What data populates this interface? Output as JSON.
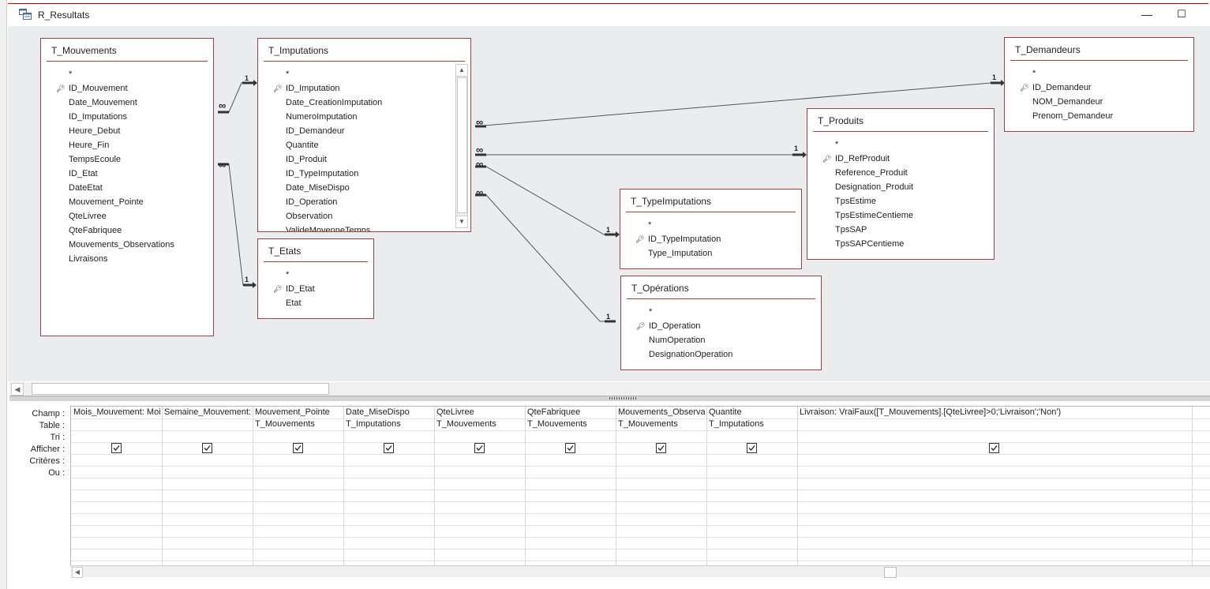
{
  "window": {
    "title": "R_Resultats",
    "minimize_glyph": "—",
    "maximize_glyph": "☐"
  },
  "tables": {
    "t_mouvements": {
      "name": "T_Mouvements",
      "fields": [
        "*",
        "ID_Mouvement",
        "Date_Mouvement",
        "ID_Imputations",
        "Heure_Debut",
        "Heure_Fin",
        "TempsEcoule",
        "ID_Etat",
        "DateEtat",
        "Mouvement_Pointe",
        "QteLivree",
        "QteFabriquee",
        "Mouvements_Observations",
        "Livraisons"
      ],
      "key_field": "ID_Mouvement"
    },
    "t_imputations": {
      "name": "T_Imputations",
      "fields": [
        "*",
        "ID_Imputation",
        "Date_CreationImputation",
        "NumeroImputation",
        "ID_Demandeur",
        "Quantite",
        "ID_Produit",
        "ID_TypeImputation",
        "Date_MiseDispo",
        "ID_Operation",
        "Observation",
        "ValideMoyenneTemps"
      ],
      "key_field": "ID_Imputation"
    },
    "t_etats": {
      "name": "T_Etats",
      "fields": [
        "*",
        "ID_Etat",
        "Etat"
      ],
      "key_field": "ID_Etat"
    },
    "t_demandeurs": {
      "name": "T_Demandeurs",
      "fields": [
        "*",
        "ID_Demandeur",
        "NOM_Demandeur",
        "Prenom_Demandeur"
      ],
      "key_field": "ID_Demandeur"
    },
    "t_produits": {
      "name": "T_Produits",
      "fields": [
        "*",
        "ID_RefProduit",
        "Reference_Produit",
        "Designation_Produit",
        "TpsEstime",
        "TpsEstimeCentieme",
        "TpsSAP",
        "TpsSAPCentieme"
      ],
      "key_field": "ID_RefProduit"
    },
    "t_typeimputations": {
      "name": "T_TypeImputations",
      "fields": [
        "*",
        "ID_TypeImputation",
        "Type_Imputation"
      ],
      "key_field": "ID_TypeImputation"
    },
    "t_operations": {
      "name": "T_Opérations",
      "fields": [
        "*",
        "ID_Operation",
        "NumOperation",
        "DesignationOperation"
      ],
      "key_field": "ID_Operation"
    }
  },
  "relationship_labels": {
    "one": "1",
    "many": "∞"
  },
  "grid": {
    "row_labels": [
      "Champ :",
      "Table :",
      "Tri :",
      "Afficher :",
      "Critères :",
      "Ou :"
    ],
    "columns": [
      {
        "champ": "Mois_Mouvement: Mois",
        "table": "",
        "afficher": true
      },
      {
        "champ": "Semaine_Mouvement:",
        "table": "",
        "afficher": true
      },
      {
        "champ": "Mouvement_Pointe",
        "table": "T_Mouvements",
        "afficher": true
      },
      {
        "champ": "Date_MiseDispo",
        "table": "T_Imputations",
        "afficher": true
      },
      {
        "champ": "QteLivree",
        "table": "T_Mouvements",
        "afficher": true
      },
      {
        "champ": "QteFabriquee",
        "table": "T_Mouvements",
        "afficher": true
      },
      {
        "champ": "Mouvements_Observations",
        "table": "T_Mouvements",
        "afficher": true
      },
      {
        "champ": "Quantite",
        "table": "T_Imputations",
        "afficher": true
      },
      {
        "champ": "Livraison: VraiFaux([T_Mouvements].[QteLivree]>0;'Livraison';'Non')",
        "table": "",
        "afficher": true
      }
    ]
  }
}
